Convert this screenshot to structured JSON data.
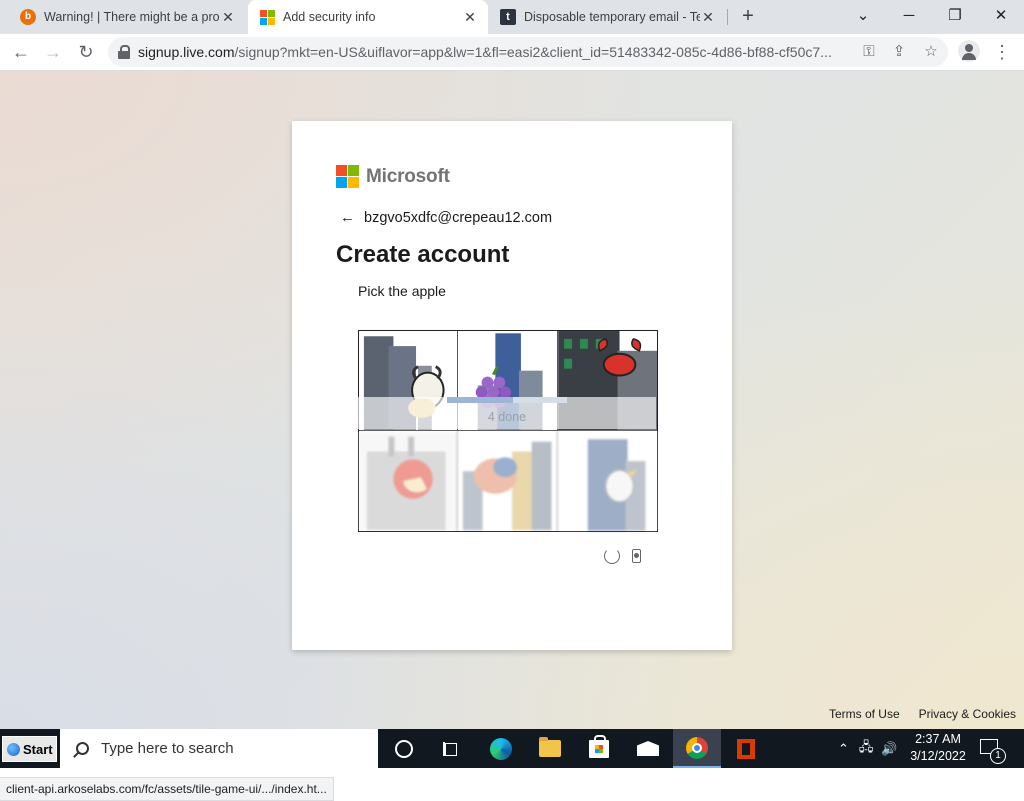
{
  "browser": {
    "tabs": [
      {
        "title": "Warning! | There might be a problem",
        "active": false,
        "favicon": "warning-icon"
      },
      {
        "title": "Add security info",
        "active": true,
        "favicon": "microsoft-icon"
      },
      {
        "title": "Disposable temporary email - Temp",
        "active": false,
        "favicon": "temp-mail-icon"
      }
    ],
    "new_tab_label": "+",
    "url_host": "signup.live.com",
    "url_path": "/signup?mkt=en-US&uiflavor=app&lw=1&fl=easi2&client_id=51483342-085c-4d86-bf88-cf50c7...",
    "status_url": "client-api.arkoselabs.com/fc/assets/tile-game-ui/.../index.ht..."
  },
  "signup": {
    "brand": "Microsoft",
    "identity": "bzgvo5xdfc@crepeau12.com",
    "heading": "Create account",
    "prompt": "Pick the apple",
    "progress_text": "4 done",
    "progress_fraction": 0.55,
    "tiles": [
      {
        "subject": "goat",
        "faded": false
      },
      {
        "subject": "grapes",
        "faded": false
      },
      {
        "subject": "crab",
        "faded": false
      },
      {
        "subject": "apple",
        "faded": true,
        "selected": true
      },
      {
        "subject": "elephant",
        "faded": true
      },
      {
        "subject": "bird",
        "faded": true
      }
    ]
  },
  "footer": {
    "terms": "Terms of Use",
    "privacy": "Privacy & Cookies"
  },
  "taskbar": {
    "start_label": "Start",
    "search_placeholder": "Type here to search",
    "time": "2:37 AM",
    "date": "3/12/2022",
    "notification_count": "1"
  },
  "colors": {
    "ms_red": "#f25022",
    "ms_green": "#7fba00",
    "ms_blue": "#00a4ef",
    "ms_yellow": "#ffb900"
  }
}
